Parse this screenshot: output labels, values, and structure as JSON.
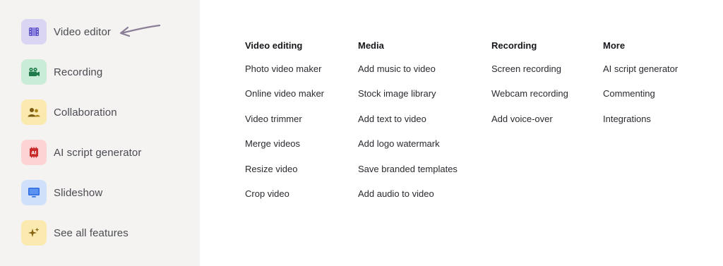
{
  "sidebar": {
    "items": [
      {
        "label": "Video editor",
        "icon": "film-icon",
        "color": "#d9d5f2"
      },
      {
        "label": "Recording",
        "icon": "camera-icon",
        "color": "#c9ecd6"
      },
      {
        "label": "Collaboration",
        "icon": "users-icon",
        "color": "#fbeab0"
      },
      {
        "label": "AI script generator",
        "icon": "ai-icon",
        "color": "#fdd3d3"
      },
      {
        "label": "Slideshow",
        "icon": "monitor-icon",
        "color": "#cfe0fb"
      },
      {
        "label": "See all features",
        "icon": "sparkle-icon",
        "color": "#fbeab0"
      }
    ]
  },
  "menu": {
    "columns": [
      {
        "heading": "Video editing",
        "links": [
          "Photo video maker",
          "Online video maker",
          "Video trimmer",
          "Merge videos",
          "Resize video",
          "Crop video"
        ]
      },
      {
        "heading": "Media",
        "links": [
          "Add music to video",
          "Stock image library",
          "Add text to video",
          "Add logo watermark",
          "Save branded templates",
          "Add audio to video"
        ]
      },
      {
        "heading": "Recording",
        "links": [
          "Screen recording",
          "Webcam recording",
          "Add voice-over"
        ]
      },
      {
        "heading": "More",
        "links": [
          "AI script generator",
          "Commenting",
          "Integrations"
        ]
      }
    ]
  }
}
